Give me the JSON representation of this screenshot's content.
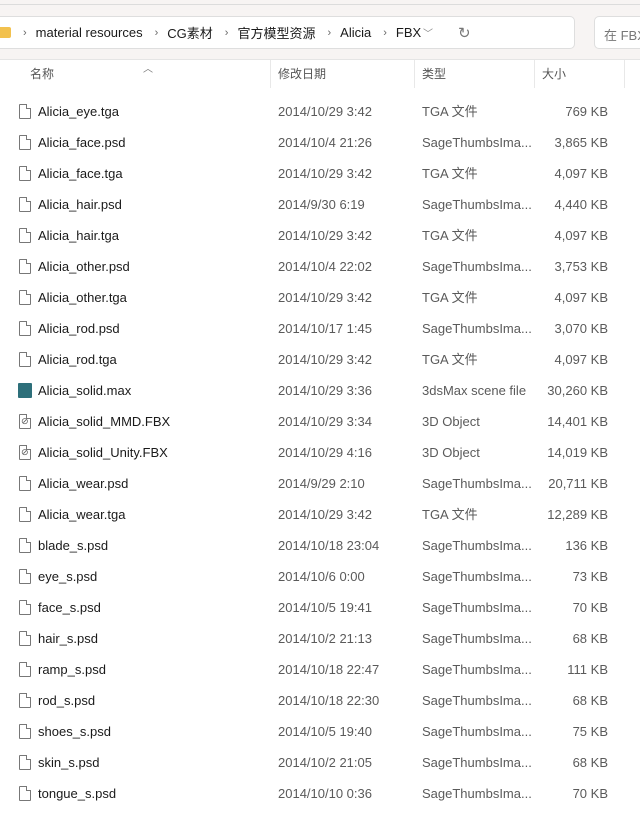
{
  "address": {
    "crumbs": [
      "material resources",
      "CG素材",
      "官方模型资源",
      "Alicia",
      "FBX"
    ],
    "search_placeholder": "在 FBX"
  },
  "columns": {
    "name": "名称",
    "date": "修改日期",
    "type": "类型",
    "size": "大小"
  },
  "files": [
    {
      "name": "Alicia_eye.tga",
      "date": "2014/10/29 3:42",
      "type": "TGA 文件",
      "size": "769 KB",
      "icon": "file"
    },
    {
      "name": "Alicia_face.psd",
      "date": "2014/10/4 21:26",
      "type": "SageThumbsIma...",
      "size": "3,865 KB",
      "icon": "file"
    },
    {
      "name": "Alicia_face.tga",
      "date": "2014/10/29 3:42",
      "type": "TGA 文件",
      "size": "4,097 KB",
      "icon": "file"
    },
    {
      "name": "Alicia_hair.psd",
      "date": "2014/9/30 6:19",
      "type": "SageThumbsIma...",
      "size": "4,440 KB",
      "icon": "file"
    },
    {
      "name": "Alicia_hair.tga",
      "date": "2014/10/29 3:42",
      "type": "TGA 文件",
      "size": "4,097 KB",
      "icon": "file"
    },
    {
      "name": "Alicia_other.psd",
      "date": "2014/10/4 22:02",
      "type": "SageThumbsIma...",
      "size": "3,753 KB",
      "icon": "file"
    },
    {
      "name": "Alicia_other.tga",
      "date": "2014/10/29 3:42",
      "type": "TGA 文件",
      "size": "4,097 KB",
      "icon": "file"
    },
    {
      "name": "Alicia_rod.psd",
      "date": "2014/10/17 1:45",
      "type": "SageThumbsIma...",
      "size": "3,070 KB",
      "icon": "file"
    },
    {
      "name": "Alicia_rod.tga",
      "date": "2014/10/29 3:42",
      "type": "TGA 文件",
      "size": "4,097 KB",
      "icon": "file"
    },
    {
      "name": "Alicia_solid.max",
      "date": "2014/10/29 3:36",
      "type": "3dsMax scene file",
      "size": "30,260 KB",
      "icon": "max"
    },
    {
      "name": "Alicia_solid_MMD.FBX",
      "date": "2014/10/29 3:34",
      "type": "3D Object",
      "size": "14,401 KB",
      "icon": "obj"
    },
    {
      "name": "Alicia_solid_Unity.FBX",
      "date": "2014/10/29 4:16",
      "type": "3D Object",
      "size": "14,019 KB",
      "icon": "obj"
    },
    {
      "name": "Alicia_wear.psd",
      "date": "2014/9/29 2:10",
      "type": "SageThumbsIma...",
      "size": "20,711 KB",
      "icon": "file"
    },
    {
      "name": "Alicia_wear.tga",
      "date": "2014/10/29 3:42",
      "type": "TGA 文件",
      "size": "12,289 KB",
      "icon": "file"
    },
    {
      "name": "blade_s.psd",
      "date": "2014/10/18 23:04",
      "type": "SageThumbsIma...",
      "size": "136 KB",
      "icon": "file"
    },
    {
      "name": "eye_s.psd",
      "date": "2014/10/6 0:00",
      "type": "SageThumbsIma...",
      "size": "73 KB",
      "icon": "file"
    },
    {
      "name": "face_s.psd",
      "date": "2014/10/5 19:41",
      "type": "SageThumbsIma...",
      "size": "70 KB",
      "icon": "file"
    },
    {
      "name": "hair_s.psd",
      "date": "2014/10/2 21:13",
      "type": "SageThumbsIma...",
      "size": "68 KB",
      "icon": "file"
    },
    {
      "name": "ramp_s.psd",
      "date": "2014/10/18 22:47",
      "type": "SageThumbsIma...",
      "size": "111 KB",
      "icon": "file"
    },
    {
      "name": "rod_s.psd",
      "date": "2014/10/18 22:30",
      "type": "SageThumbsIma...",
      "size": "68 KB",
      "icon": "file"
    },
    {
      "name": "shoes_s.psd",
      "date": "2014/10/5 19:40",
      "type": "SageThumbsIma...",
      "size": "75 KB",
      "icon": "file"
    },
    {
      "name": "skin_s.psd",
      "date": "2014/10/2 21:05",
      "type": "SageThumbsIma...",
      "size": "68 KB",
      "icon": "file"
    },
    {
      "name": "tongue_s.psd",
      "date": "2014/10/10 0:36",
      "type": "SageThumbsIma...",
      "size": "70 KB",
      "icon": "file"
    }
  ]
}
